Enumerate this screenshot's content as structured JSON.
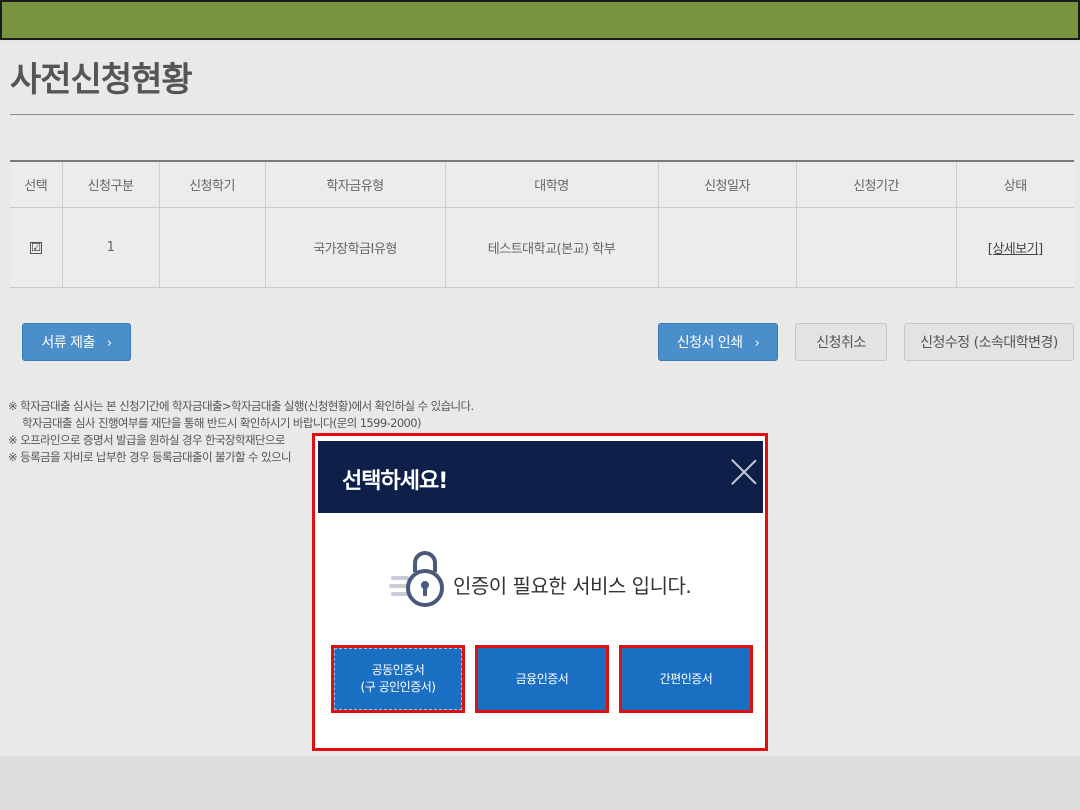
{
  "page": {
    "title": "사전신청현황"
  },
  "table": {
    "headers": [
      "선택",
      "신청구분",
      "신청학기",
      "학자금유형",
      "대학명",
      "신청일자",
      "신청기간",
      "상태"
    ],
    "row": {
      "selected": "☑",
      "type_no": "1",
      "semester": "",
      "loan_type": "국가장학금I유형",
      "university": "테스트대학교(본교) 학부",
      "apply_date": "",
      "apply_period": "",
      "status_link": "[상세보기]"
    }
  },
  "buttons": {
    "submit_docs": "서류 제출",
    "print_form": "신청서 인쇄",
    "cancel_apply": "신청취소",
    "modify_apply": "신청수정 (소속대학변경)",
    "chevron": "›"
  },
  "notes": {
    "line1": "※ 학자금대출 심사는 본 신청기간에 학자금대출>학자금대출 실행(신청현황)에서 확인하실 수 있습니다.",
    "line2": "학자금대출 심사 진행여부를 재단을 통해 반드시 확인하시기 바랍니다(문의 1599-2000)",
    "line3": "※ 오프라인으로 증명서 발급을 원하실 경우 한국장학재단으로",
    "line4": "※ 등록금을 자비로 납부한 경우 등록금대출이 불가할 수 있으니"
  },
  "modal": {
    "title": "선택하세요!",
    "message": "인증이 필요한 서비스 입니다.",
    "cert_joint_line1": "공동인증서",
    "cert_joint_line2": "(구 공인인증서)",
    "cert_financial": "금융인증서",
    "cert_simple": "간편인증서"
  },
  "colors": {
    "top_bar": "#7a9540",
    "modal_header": "#0e1f4a",
    "primary_blue": "#1b6fc3",
    "highlight_red": "#e01010"
  }
}
